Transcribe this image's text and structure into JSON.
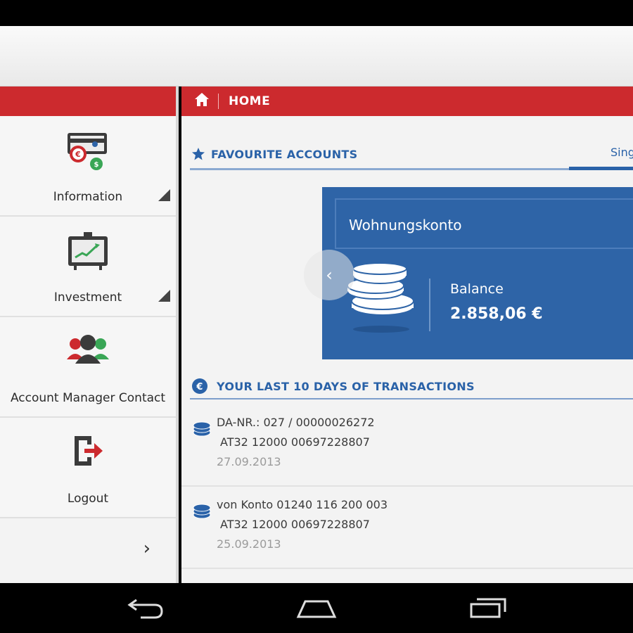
{
  "header": {
    "title": "HOME"
  },
  "sidebar": {
    "items": [
      {
        "label": "Information",
        "icon": "money-exchange-icon",
        "expandable": true
      },
      {
        "label": "Investment",
        "icon": "chart-board-icon",
        "expandable": true
      },
      {
        "label": "Account Manager Contact",
        "icon": "people-icon",
        "expandable": false
      },
      {
        "label": "Logout",
        "icon": "logout-icon",
        "expandable": false
      }
    ],
    "more_glyph": "›"
  },
  "favourites": {
    "title": "FAVOURITE ACCOUNTS",
    "tab_label": "Sing",
    "account": {
      "name": "Wohnungskonto",
      "balance_label": "Balance",
      "balance_value": "2.858,06 €"
    }
  },
  "transactions": {
    "title": "YOUR LAST 10 DAYS OF TRANSACTIONS",
    "items": [
      {
        "line1": "DA-NR.: 027 / 00000026272",
        "line2": "AT32 12000 00697228807",
        "date": "27.09.2013"
      },
      {
        "line1": "von Konto 01240 116 200 003",
        "line2": "AT32 12000 00697228807",
        "date": "25.09.2013"
      }
    ]
  },
  "colors": {
    "brand_red": "#cc2a2e",
    "brand_blue": "#2e64a7"
  }
}
